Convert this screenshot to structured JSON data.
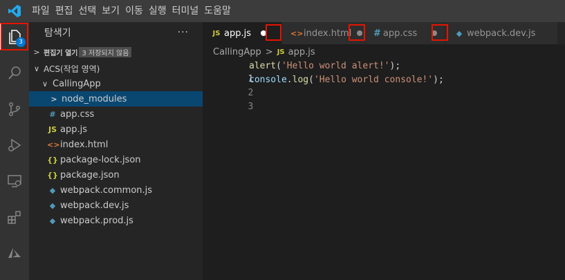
{
  "menu": [
    "파일",
    "편집",
    "선택",
    "보기",
    "이동",
    "실행",
    "터미널",
    "도움말"
  ],
  "activity": {
    "explorer_badge": "3",
    "items": [
      "explorer-icon",
      "search-icon",
      "source-control-icon",
      "run-debug-icon",
      "remote-explorer-icon",
      "extensions-icon",
      "azure-icon"
    ]
  },
  "sidebar": {
    "title": "탐색기",
    "more": "···",
    "open_editors_label": "편집기 열기",
    "open_editors_unsaved": "3 저장되지 않음",
    "workspace_label": "ACS(작업 영역)",
    "folder": "CallingApp",
    "files": [
      {
        "name": "node_modules",
        "icon": "chevron-right-icon",
        "symbol": ">",
        "color": "#cccccc",
        "selected": true
      },
      {
        "name": "app.css",
        "icon": "css-file-icon",
        "symbol": "#",
        "color": "#519aba"
      },
      {
        "name": "app.js",
        "icon": "js-file-icon",
        "symbol": "JS",
        "color": "#cbcb41"
      },
      {
        "name": "index.html",
        "icon": "html-file-icon",
        "symbol": "<>",
        "color": "#e37933"
      },
      {
        "name": "package-lock.json",
        "icon": "json-file-icon",
        "symbol": "{}",
        "color": "#cbcb41"
      },
      {
        "name": "package.json",
        "icon": "json-file-icon",
        "symbol": "{}",
        "color": "#cbcb41"
      },
      {
        "name": "webpack.common.js",
        "icon": "webpack-file-icon",
        "symbol": "◆",
        "color": "#519aba"
      },
      {
        "name": "webpack.dev.js",
        "icon": "webpack-file-icon",
        "symbol": "◆",
        "color": "#519aba"
      },
      {
        "name": "webpack.prod.js",
        "icon": "webpack-file-icon",
        "symbol": "◆",
        "color": "#519aba"
      }
    ]
  },
  "tabs": [
    {
      "label": "app.js",
      "symbol": "JS",
      "color": "#cbcb41",
      "active": true
    },
    {
      "label": "index.html",
      "symbol": "<>",
      "color": "#e37933",
      "active": false
    },
    {
      "label": "app.css",
      "symbol": "#",
      "color": "#519aba",
      "active": false
    },
    {
      "label": "webpack.dev.js",
      "symbol": "◆",
      "color": "#519aba",
      "active": false
    }
  ],
  "breadcrumb": {
    "folder": "CallingApp",
    "separator": ">",
    "file_symbol": "JS",
    "file": "app.js"
  },
  "code": {
    "line_numbers": [
      "1",
      "2",
      "3"
    ],
    "line1": {
      "fn": "alert",
      "open": "(",
      "str": "'Hello world alert!'",
      "close": ");"
    },
    "line2": {
      "obj": "console",
      "dot": ".",
      "fn": "log",
      "open": "(",
      "str": "'Hello world console!'",
      "close": ");"
    }
  }
}
